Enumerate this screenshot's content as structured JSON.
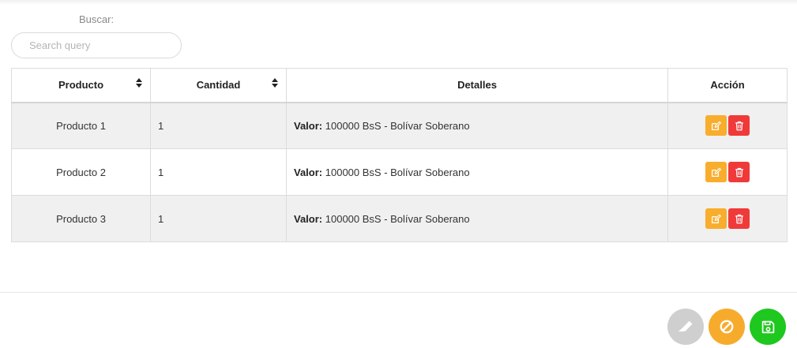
{
  "search": {
    "label": "Buscar:",
    "placeholder": "Search query",
    "value": ""
  },
  "table": {
    "columns": [
      "Producto",
      "Cantidad",
      "Detalles",
      "Acción"
    ],
    "rows": [
      {
        "producto": "Producto 1",
        "cantidad": "1",
        "detalle_label": "Valor:",
        "detalle_value": "100000 BsS - Bolívar Soberano"
      },
      {
        "producto": "Producto 2",
        "cantidad": "1",
        "detalle_label": "Valor:",
        "detalle_value": "100000 BsS - Bolívar Soberano"
      },
      {
        "producto": "Producto 3",
        "cantidad": "1",
        "detalle_label": "Valor:",
        "detalle_value": "100000 BsS - Bolívar Soberano"
      }
    ]
  },
  "row_actions": {
    "edit_icon": "edit-icon",
    "delete_icon": "trash-icon"
  },
  "footer_actions": {
    "clear_icon": "eraser-icon",
    "cancel_icon": "ban-icon",
    "save_icon": "save-icon"
  },
  "colors": {
    "edit": "#f9ad2d",
    "delete": "#f03a3a",
    "clear": "#cfcfcf",
    "cancel": "#f7ab2c",
    "save": "#1ec81e"
  }
}
